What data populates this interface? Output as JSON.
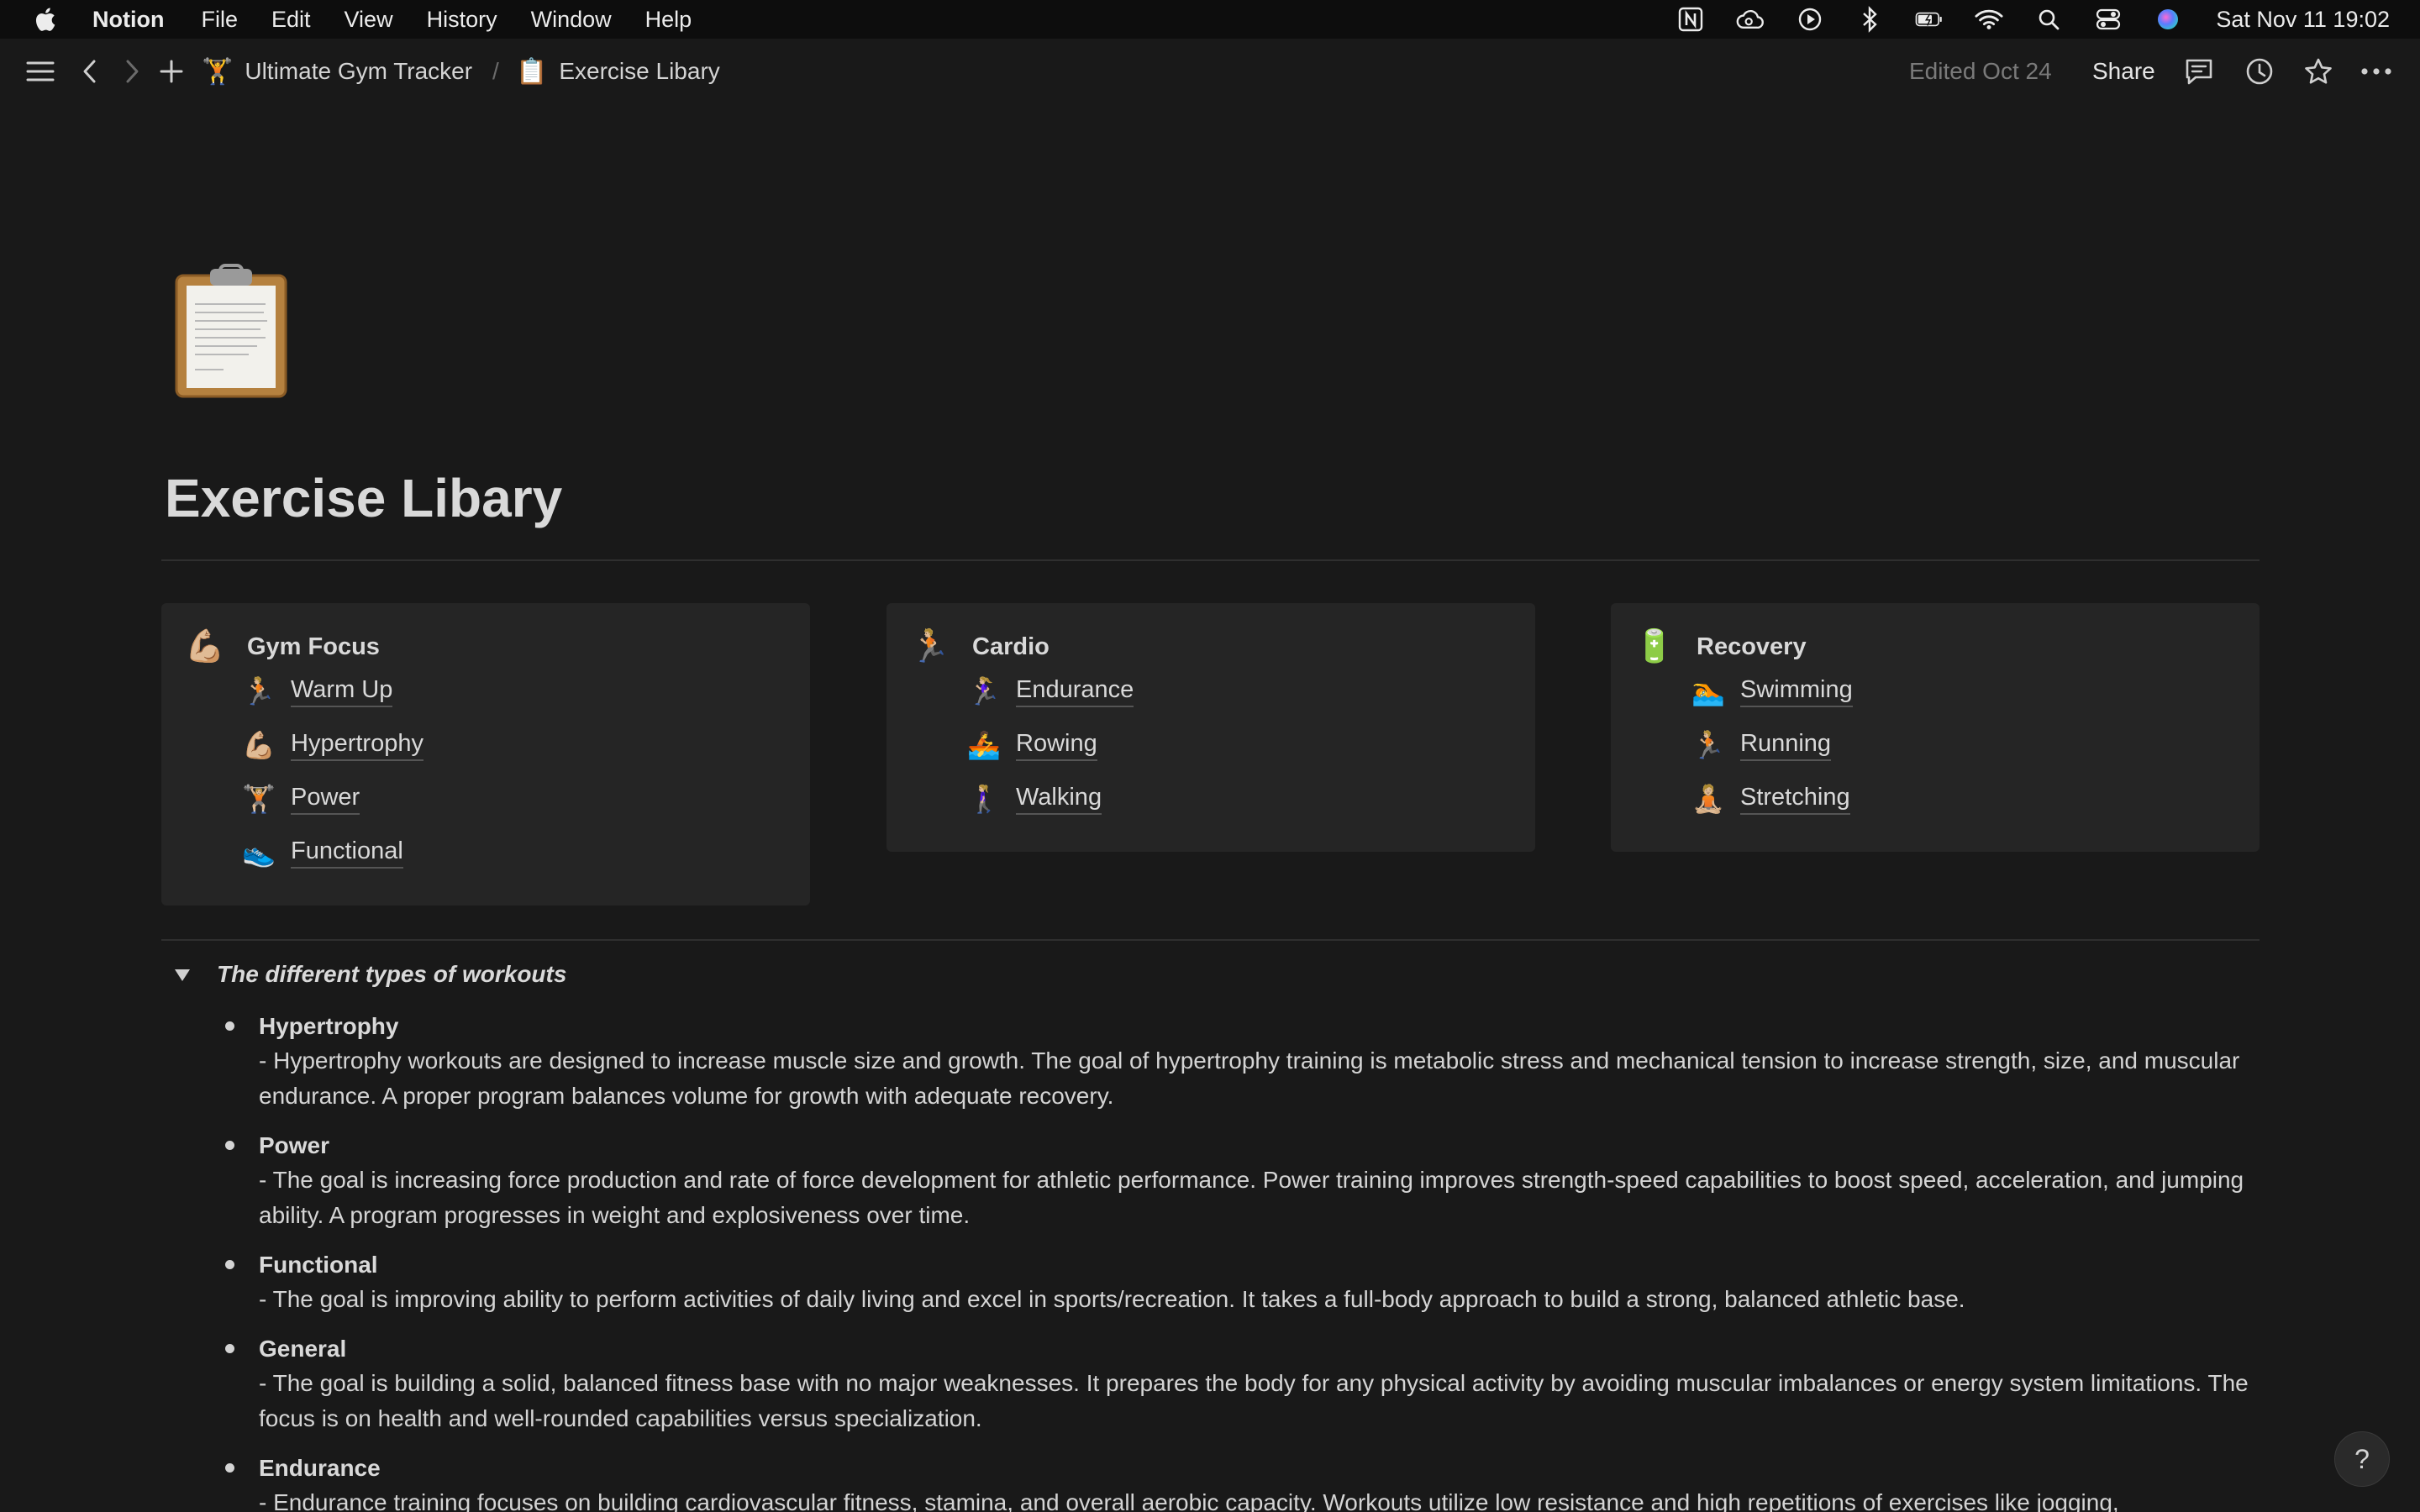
{
  "menubar": {
    "app_name": "Notion",
    "menus": [
      "File",
      "Edit",
      "View",
      "History",
      "Window",
      "Help"
    ],
    "tray_icons": [
      "notion-icon",
      "creative-cloud-icon",
      "play-icon",
      "bluetooth-icon",
      "battery-icon",
      "wifi-icon",
      "spotlight-icon",
      "control-center-icon",
      "siri-icon"
    ],
    "clock": "Sat Nov 11  19:02"
  },
  "toolbar": {
    "breadcrumbs": [
      {
        "emoji": "🏋️",
        "label": "Ultimate Gym Tracker"
      },
      {
        "emoji": "📋",
        "label": "Exercise Libary"
      }
    ],
    "separator": "/",
    "edited": "Edited Oct 24",
    "share": "Share"
  },
  "page": {
    "icon": "clipboard-icon",
    "title": "Exercise Libary"
  },
  "cards": [
    {
      "emoji": "💪🏼",
      "title": "Gym Focus",
      "items": [
        {
          "emoji": "🏃🏼",
          "label": "Warm Up"
        },
        {
          "emoji": "💪🏼",
          "label": "Hypertrophy"
        },
        {
          "emoji": "🏋🏼",
          "label": "Power"
        },
        {
          "emoji": "👟",
          "label": "Functional"
        }
      ]
    },
    {
      "emoji": "🏃🏼",
      "title": "Cardio",
      "items": [
        {
          "emoji": "🏃🏼‍♀️",
          "label": "Endurance"
        },
        {
          "emoji": "🚣",
          "label": "Rowing"
        },
        {
          "emoji": "🚶🏼‍♀️",
          "label": "Walking"
        }
      ]
    },
    {
      "emoji": "🔋",
      "title": "Recovery",
      "items": [
        {
          "emoji": "🏊",
          "label": "Swimming"
        },
        {
          "emoji": "🏃🏼",
          "label": "Running"
        },
        {
          "emoji": "🧘🏼",
          "label": "Stretching"
        }
      ]
    }
  ],
  "toggle": {
    "title": "The different types of workouts",
    "items": [
      {
        "title": "Hypertrophy",
        "body": "- Hypertrophy workouts are designed to increase muscle size and growth. The goal of hypertrophy training is metabolic stress and mechanical tension to increase strength, size, and muscular endurance. A proper program balances volume for growth with adequate recovery."
      },
      {
        "title": "Power",
        "body": "- The goal is increasing force production and rate of force development for athletic performance. Power training improves strength-speed capabilities to boost speed, acceleration, and jumping ability. A program progresses in weight and explosiveness over time."
      },
      {
        "title": "Functional",
        "body": "- The goal is improving ability to perform activities of daily living and excel in sports/recreation. It takes a full-body approach to build a strong, balanced athletic base."
      },
      {
        "title": "General",
        "body": "- The goal is building a solid, balanced fitness base with no major weaknesses. It prepares the body for any physical activity by avoiding muscular imbalances or energy system limitations. The focus is on health and well-rounded capabilities versus specialization."
      },
      {
        "title": "Endurance",
        "body": "- Endurance training focuses on building cardiovascular fitness, stamina, and overall aerobic capacity. Workouts utilize low resistance and high repetitions of exercises like jogging,"
      }
    ]
  },
  "help": "?"
}
